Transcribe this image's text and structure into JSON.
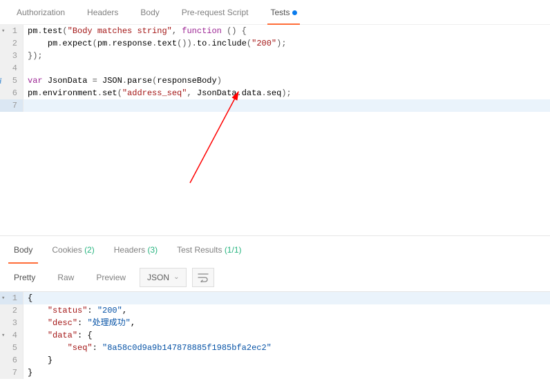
{
  "top_tabs": {
    "authorization": "Authorization",
    "headers": "Headers",
    "body": "Body",
    "prerequest": "Pre-request Script",
    "tests": "Tests"
  },
  "editor": {
    "lines": [
      "pm.test(\"Body matches string\", function () {",
      "    pm.expect(pm.response.text()).to.include(\"200\");",
      "});",
      "",
      "var JsonData = JSON.parse(responseBody)",
      "pm.environment.set(\"address_seq\", JsonData.data.seq);",
      ""
    ]
  },
  "bottom_tabs": {
    "body": "Body",
    "cookies": "Cookies",
    "cookies_count": "(2)",
    "headers": "Headers",
    "headers_count": "(3)",
    "test_results": "Test Results",
    "test_results_count": "(1/1)"
  },
  "toolbar": {
    "pretty": "Pretty",
    "raw": "Raw",
    "preview": "Preview",
    "format": "JSON"
  },
  "response": {
    "status_key": "\"status\"",
    "status_val": "\"200\"",
    "desc_key": "\"desc\"",
    "desc_val": "\"处理成功\"",
    "data_key": "\"data\"",
    "seq_key": "\"seq\"",
    "seq_val": "\"8a58c0d9a9b147878885f1985bfa2ec2\""
  }
}
